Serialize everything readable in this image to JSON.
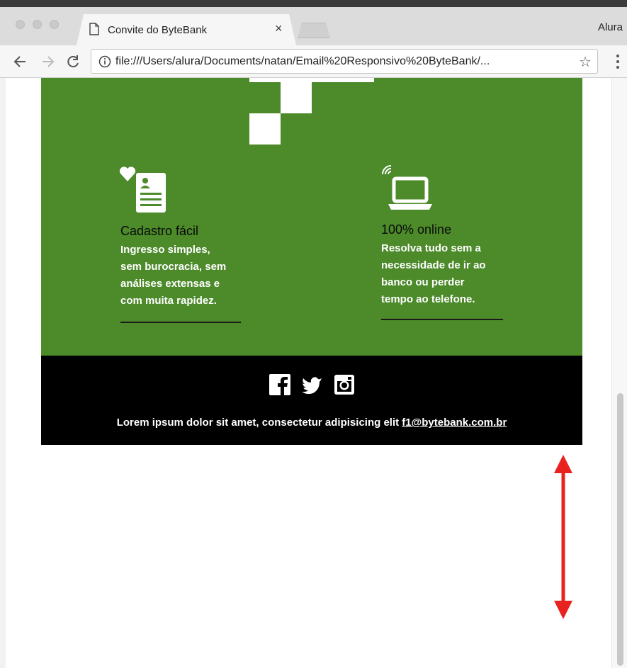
{
  "browser": {
    "tab_title": "Convite do ByteBank",
    "tab_close": "×",
    "profile_name": "Alura",
    "address_url": "file:///Users/alura/Documents/natan/Email%20Responsivo%20ByteBank/...",
    "star": "☆"
  },
  "email": {
    "colors": {
      "green": "#4c8a2a",
      "footer": "#000000"
    },
    "features": [
      {
        "icon": "profile-card-heart-icon",
        "title": "Cadastro fácil",
        "description_lines": [
          "Ingresso simples,",
          "sem burocracia, sem",
          "análises extensas e",
          "com muita rapidez."
        ]
      },
      {
        "icon": "laptop-wifi-icon",
        "title": "100% online",
        "description_lines": [
          "Resolva tudo sem a",
          "necessidade de ir ao",
          "banco ou perder",
          "tempo ao telefone."
        ]
      }
    ],
    "footer": {
      "social_icons": [
        "facebook-icon",
        "twitter-icon",
        "instagram-icon"
      ],
      "text": "Lorem ipsum dolor sit amet, consectetur adipisicing elit",
      "email": "f1@bytebank.com.br"
    }
  },
  "annotation": {
    "color": "#e8231f",
    "icon": "double-headed-arrow-icon"
  }
}
